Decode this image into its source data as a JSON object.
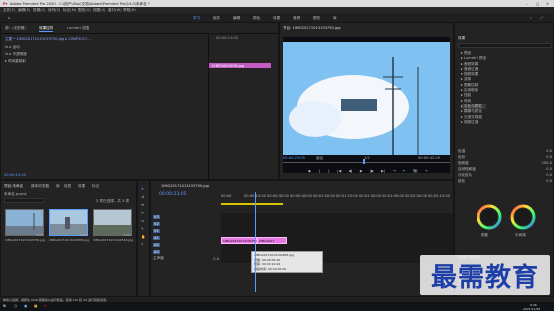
{
  "title_bar": {
    "title": "Adobe Premiere Pro 2020 - C:\\用户\\Ship\\文档\\Adobe\\Premiere Pro\\14.0\\未命名 *",
    "min": "–",
    "max": "□",
    "close": "✕"
  },
  "menu": [
    "文件(F)",
    "编辑(E)",
    "剪辑(C)",
    "序列(S)",
    "标记(M)",
    "图形(G)",
    "视图(V)",
    "窗口(W)",
    "帮助(H)"
  ],
  "workspaces": [
    "学习",
    "组件",
    "编辑",
    "颜色",
    "效果",
    "音频",
    "图形",
    "库"
  ],
  "source_panel": {
    "tabs": [
      "源：(无剪辑)",
      "效果控件",
      "Lumetri 范围"
    ],
    "master_row": "主要 * 1IMG20171013193750.jpg  ▸  10MP2017...",
    "rows": [
      "fx ▸ 运动",
      "fx ▸ 不透明度",
      "▸ 时间重映射"
    ],
    "mini_timecode": "00:00:15:00",
    "clip_label": "15BFDXK1SHR.jpg",
    "bottom_timecode": "00:00:15:00"
  },
  "program": {
    "tab": "节目: 1IMG20171013193750.jpg",
    "timecode": "00:00:23:05",
    "fit": "适合",
    "ratio": "1/2",
    "duration": "00:00:42:29",
    "controls": [
      "◆",
      "{",
      "}",
      "|◀",
      "◀|",
      "▶",
      "|▶",
      "▶|",
      "⇥",
      "⇤",
      "📷",
      "+"
    ]
  },
  "project_panel": {
    "tabs": [
      "项目:未命名",
      "媒体浏览器",
      "库",
      "信息",
      "效果",
      "标记"
    ],
    "path": "未命名.prproj",
    "item_count": "3 项已选择，共 3 项",
    "items": [
      {
        "name": "1IMG20171013193750.jpg",
        "duration": "5:00"
      },
      {
        "name": "2IMG20171013192805.jpg",
        "duration": "5:00"
      },
      {
        "name": "3IMG20171013192543.jpg",
        "duration": "5:00"
      }
    ]
  },
  "timeline": {
    "tab": "1IMG20171013193750.jpg",
    "timecode": "00:00:23:05",
    "ruler": [
      "00:00",
      "00:00:15:00",
      "00:00:30:00",
      "00:00:45:00",
      "00:01:00:00",
      "00:01:15:00",
      "00:01:30:00",
      "00:01:45:00",
      "00:02:00:00",
      "00:02:15:00"
    ],
    "tracks": [
      "V3",
      "V2",
      "V1",
      "A1",
      "A2",
      "A3"
    ],
    "master": "主声道",
    "master_value": "0.0",
    "clips": [
      {
        "label": "1IMG20171013193750.jpg",
        "color": "#e27be0"
      },
      {
        "label": "2IMG2017",
        "color": "#e27be0"
      },
      {
        "label": "3IMG2017101319254",
        "color": "#e27be0"
      }
    ],
    "tooltip": {
      "line1": "2IMG20171013192805.jpg",
      "line2": "开始: 00:00:05:00",
      "line3": "结束: 00:00:10:00",
      "line4": "持续时间: 00:00:05:00"
    }
  },
  "effects_panel": {
    "tab": "效果",
    "search_placeholder": "",
    "tree": [
      "▸ 预设",
      "▸ Lumetri 预设",
      "▸ 音频效果",
      "▸ 音频过渡",
      "▾ 视频效果",
      "   ▸ 变换",
      "   ▸ 图像控制",
      "   ▸ 实用程序",
      "   ▸ 扭曲",
      "   ▸ 时间",
      "   ▸ 杂色与颗粒",
      "   ▸ 模糊与锐化",
      "   ▸ 沉浸式视频",
      "▸ 视频过渡"
    ],
    "params": [
      {
        "label": "色温",
        "value": "0.0"
      },
      {
        "label": "色彩",
        "value": "0.0"
      },
      {
        "label": "饱和度",
        "value": "100.0"
      },
      {
        "label": "自然饱和度",
        "value": "0.0"
      },
      {
        "label": "淡化胶片",
        "value": "0.0"
      },
      {
        "label": "锐化",
        "value": "0.0"
      }
    ],
    "wheel_labels": [
      "阴影",
      "中间调",
      "高光"
    ],
    "more_params": [
      "色相与饱和度",
      "色相与色相",
      "色相与亮度"
    ]
  },
  "status": "单击以选择，或按住 Shift 键拖动以进行框选。使用 Ctrl 和 Alt 进行其他选项。",
  "watermark": "最需教育",
  "taskbar": {
    "time": "9:46",
    "date": "2021/11/25"
  }
}
